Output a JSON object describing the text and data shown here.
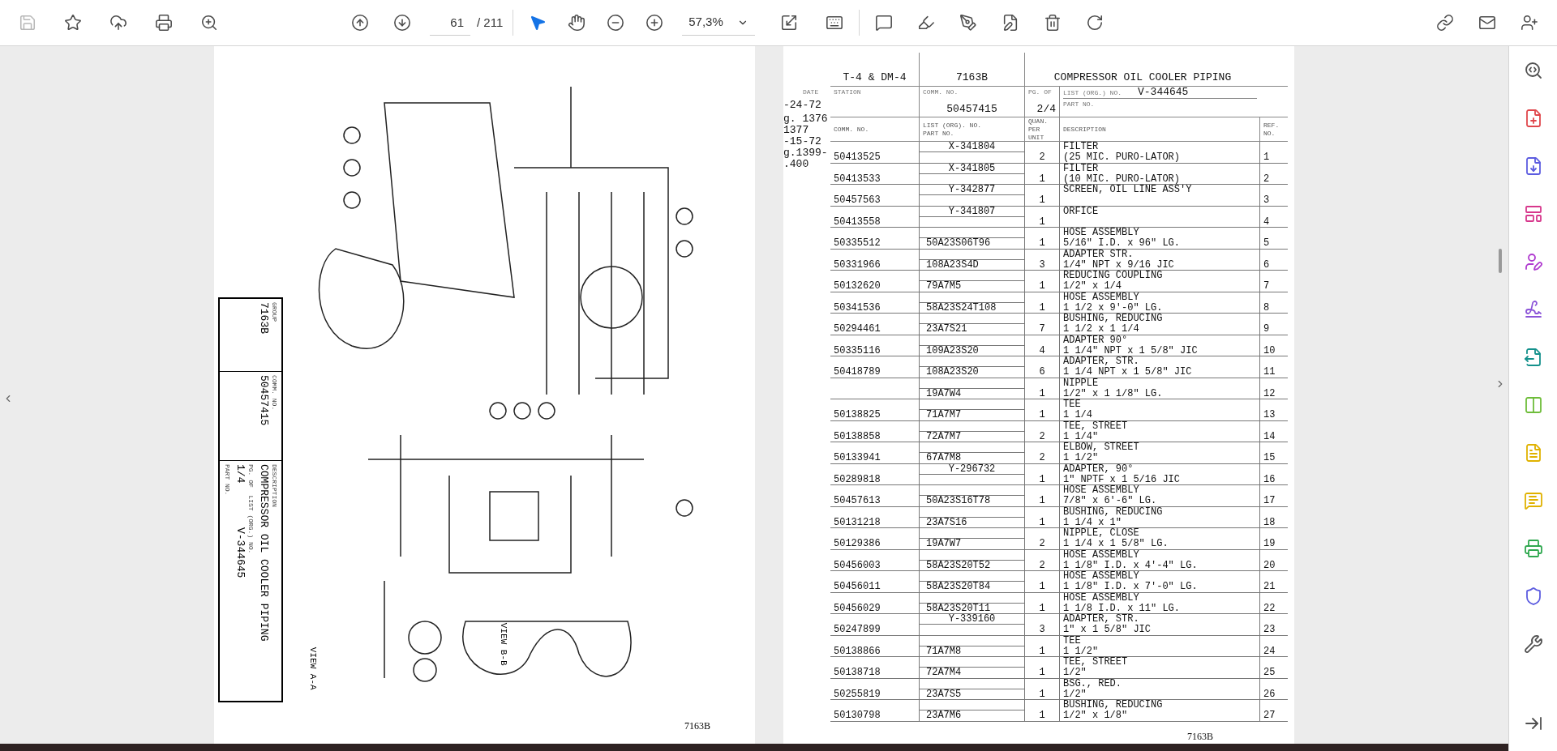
{
  "toolbar": {
    "file_tools": [
      {
        "kind": "save",
        "disabled": true
      },
      {
        "kind": "star",
        "disabled": false
      },
      {
        "kind": "upload",
        "disabled": false
      },
      {
        "kind": "print",
        "disabled": false
      },
      {
        "kind": "find",
        "disabled": false
      }
    ],
    "page_nav": [
      {
        "kind": "previous"
      },
      {
        "kind": "next"
      }
    ],
    "page_field": {
      "value": "61"
    },
    "page_total": "/ 211",
    "tools": [
      {
        "kind": "select",
        "selected": true
      },
      {
        "kind": "hand",
        "selected": false
      }
    ],
    "zoom_buttons": [
      {
        "kind": "zoom-out"
      },
      {
        "kind": "zoom-in"
      }
    ],
    "zoom_field": {
      "value": "57,3%"
    },
    "view_tools": [
      {
        "kind": "fit"
      },
      {
        "kind": "scroll"
      }
    ],
    "edit_tools": [
      {
        "kind": "comment"
      },
      {
        "kind": "highlight"
      },
      {
        "kind": "sign"
      },
      {
        "kind": "edit"
      },
      {
        "kind": "delete"
      },
      {
        "kind": "rotate"
      }
    ],
    "share_tools": [
      {
        "kind": "link"
      },
      {
        "kind": "mail"
      },
      {
        "kind": "account"
      }
    ]
  },
  "left_page": {
    "title_block": [
      {
        "kind": "label",
        "text": "GROUP"
      },
      {
        "kind": "value",
        "text": "7163B"
      },
      {
        "kind": "label",
        "text": "COMM. NO."
      },
      {
        "kind": "value",
        "text": "50457415"
      },
      {
        "kind": "label",
        "text": "DESCRIPTION"
      },
      {
        "kind": "value",
        "text": "COMPRESSOR OIL COOLER PIPING"
      },
      {
        "kind": "label",
        "text": "PG. OF  LIST (ORG.) NO."
      },
      {
        "kind": "value",
        "text": "1/4       V-344645"
      },
      {
        "kind": "label",
        "text": "PART NO."
      }
    ],
    "views": [
      "VIEW A-A",
      "VIEW B-B"
    ],
    "footer": "7163B"
  },
  "right_page": {
    "header": {
      "top": [
        "T-4 & DM-4",
        "7163B",
        "COMPRESSOR OIL COOLER PIPING"
      ],
      "labels": [
        "DATE",
        "STATION",
        "COMM. NO.",
        "PG. OF",
        "LIST (ORG.) NO.",
        "PART NO."
      ],
      "date": "-24-72",
      "comm_no": "50457415",
      "page_of": "2/4",
      "list_no": "V-344645"
    },
    "side_notes": [
      "g. 1376",
      "1377",
      "-15-72",
      "g.1399-",
      ".400"
    ],
    "columns": [
      "COMM. NO.",
      "LIST (ORG). NO.",
      "PART NO.",
      "QUAN. PER UNIT",
      "DESCRIPTION",
      "REF. NO."
    ],
    "rows": [
      {
        "comm": "50413525",
        "list_no": "X-341804",
        "part_no": "",
        "qty": "2",
        "description": [
          "FILTER",
          "(25 MIC. PURO-LATOR)"
        ],
        "ref": "1"
      },
      {
        "comm": "50413533",
        "list_no": "X-341805",
        "part_no": "",
        "qty": "1",
        "description": [
          "FILTER",
          "(10 MIC. PURO-LATOR)"
        ],
        "ref": "2"
      },
      {
        "comm": "50457563",
        "list_no": "Y-342877",
        "part_no": "",
        "qty": "1",
        "description": [
          "SCREEN, OIL LINE ASS'Y"
        ],
        "ref": "3"
      },
      {
        "comm": "50413558",
        "list_no": "Y-341807",
        "part_no": "",
        "qty": "1",
        "description": [
          "ORFICE"
        ],
        "ref": "4"
      },
      {
        "comm": "50335512",
        "list_no": "",
        "part_no": "50A23S06T96",
        "qty": "1",
        "description": [
          "HOSE ASSEMBLY",
          "5/16\" I.D. x 96\" LG."
        ],
        "ref": "5"
      },
      {
        "comm": "50331966",
        "list_no": "",
        "part_no": "108A23S4D",
        "qty": "3",
        "description": [
          "ADAPTER STR.",
          "1/4\" NPT x 9/16 JIC"
        ],
        "ref": "6"
      },
      {
        "comm": "50132620",
        "list_no": "",
        "part_no": "79A7M5",
        "qty": "1",
        "description": [
          "REDUCING COUPLING",
          "1/2\" x 1/4"
        ],
        "ref": "7"
      },
      {
        "comm": "50341536",
        "list_no": "",
        "part_no": "58A23S24T108",
        "qty": "1",
        "description": [
          "HOSE ASSEMBLY",
          "1 1/2 x 9'-0\" LG."
        ],
        "ref": "8"
      },
      {
        "comm": "50294461",
        "list_no": "",
        "part_no": "23A7S21",
        "qty": "7",
        "description": [
          "BUSHING, REDUCING",
          "1 1/2 x 1 1/4"
        ],
        "ref": "9"
      },
      {
        "comm": "50335116",
        "list_no": "",
        "part_no": "109A23S20",
        "qty": "4",
        "description": [
          "ADAPTER 90°",
          "1 1/4\" NPT x 1 5/8\" JIC"
        ],
        "ref": "10"
      },
      {
        "comm": "50418789",
        "list_no": "",
        "part_no": "108A23S20",
        "qty": "6",
        "description": [
          "ADAPTER, STR.",
          "1 1/4 NPT x 1 5/8\" JIC"
        ],
        "ref": "11"
      },
      {
        "comm": "",
        "list_no": "",
        "part_no": "19A7W4",
        "qty": "1",
        "description": [
          "NIPPLE",
          "1/2\" x 1 1/8\" LG."
        ],
        "ref": "12"
      },
      {
        "comm": "50138825",
        "list_no": "",
        "part_no": "71A7M7",
        "qty": "1",
        "description": [
          "TEE",
          "1 1/4"
        ],
        "ref": "13"
      },
      {
        "comm": "50138858",
        "list_no": "",
        "part_no": "72A7M7",
        "qty": "2",
        "description": [
          "TEE, STREET",
          "1 1/4\""
        ],
        "ref": "14"
      },
      {
        "comm": "50133941",
        "list_no": "",
        "part_no": "67A7M8",
        "qty": "2",
        "description": [
          "ELBOW, STREET",
          "1 1/2\""
        ],
        "ref": "15"
      },
      {
        "comm": "50289818",
        "list_no": "Y-296732",
        "part_no": "",
        "qty": "1",
        "description": [
          "ADAPTER, 90°",
          "1\" NPTF x 1 5/16 JIC"
        ],
        "ref": "16"
      },
      {
        "comm": "50457613",
        "list_no": "",
        "part_no": "50A23S16T78",
        "qty": "1",
        "description": [
          "HOSE ASSEMBLY",
          "7/8\" x 6'-6\" LG."
        ],
        "ref": "17"
      },
      {
        "comm": "50131218",
        "list_no": "",
        "part_no": "23A7S16",
        "qty": "1",
        "description": [
          "BUSHING, REDUCING",
          "1 1/4 x 1\""
        ],
        "ref": "18"
      },
      {
        "comm": "50129386",
        "list_no": "",
        "part_no": "19A7W7",
        "qty": "2",
        "description": [
          "NIPPLE, CLOSE",
          "1 1/4 x 1 5/8\" LG."
        ],
        "ref": "19"
      },
      {
        "comm": "50456003",
        "list_no": "",
        "part_no": "58A23S20T52",
        "qty": "2",
        "description": [
          "HOSE ASSEMBLY",
          "1 1/8\" I.D. x 4'-4\" LG."
        ],
        "ref": "20"
      },
      {
        "comm": "50456011",
        "list_no": "",
        "part_no": "58A23S20T84",
        "qty": "1",
        "description": [
          "HOSE ASSEMBLY",
          "1 1/8\" I.D. x 7'-0\" LG."
        ],
        "ref": "21"
      },
      {
        "comm": "50456029",
        "list_no": "",
        "part_no": "58A23S20T11",
        "qty": "1",
        "description": [
          "HOSE ASSEMBLY",
          "1 1/8 I.D. x 11\" LG."
        ],
        "ref": "22"
      },
      {
        "comm": "50247899",
        "list_no": "Y-339160",
        "part_no": "",
        "qty": "3",
        "description": [
          "ADAPTER, STR.",
          "1\" x 1 5/8\" JIC"
        ],
        "ref": "23"
      },
      {
        "comm": "50138866",
        "list_no": "",
        "part_no": "71A7M8",
        "qty": "1",
        "description": [
          "TEE",
          "1 1/2\""
        ],
        "ref": "24"
      },
      {
        "comm": "50138718",
        "list_no": "",
        "part_no": "72A7M4",
        "qty": "1",
        "description": [
          "TEE, STREET",
          "1/2\""
        ],
        "ref": "25"
      },
      {
        "comm": "50255819",
        "list_no": "",
        "part_no": "23A7S5",
        "qty": "1",
        "description": [
          "BSG., RED.",
          "1/2\""
        ],
        "ref": "26"
      },
      {
        "comm": "50130798",
        "list_no": "",
        "part_no": "23A7M6",
        "qty": "1",
        "description": [
          "BUSHING, REDUCING",
          "1/2\" x 1/8\""
        ],
        "ref": "27"
      }
    ],
    "footer": "7163B"
  },
  "right_panel": [
    {
      "kind": "search"
    },
    {
      "kind": "create"
    },
    {
      "kind": "combine"
    },
    {
      "kind": "organize"
    },
    {
      "kind": "request-sign"
    },
    {
      "kind": "fill-sign"
    },
    {
      "kind": "export"
    },
    {
      "kind": "compress"
    },
    {
      "kind": "scan"
    },
    {
      "kind": "comment"
    },
    {
      "kind": "print-production"
    },
    {
      "kind": "protect"
    },
    {
      "kind": "more-tools"
    },
    {
      "kind": "collapse"
    }
  ]
}
